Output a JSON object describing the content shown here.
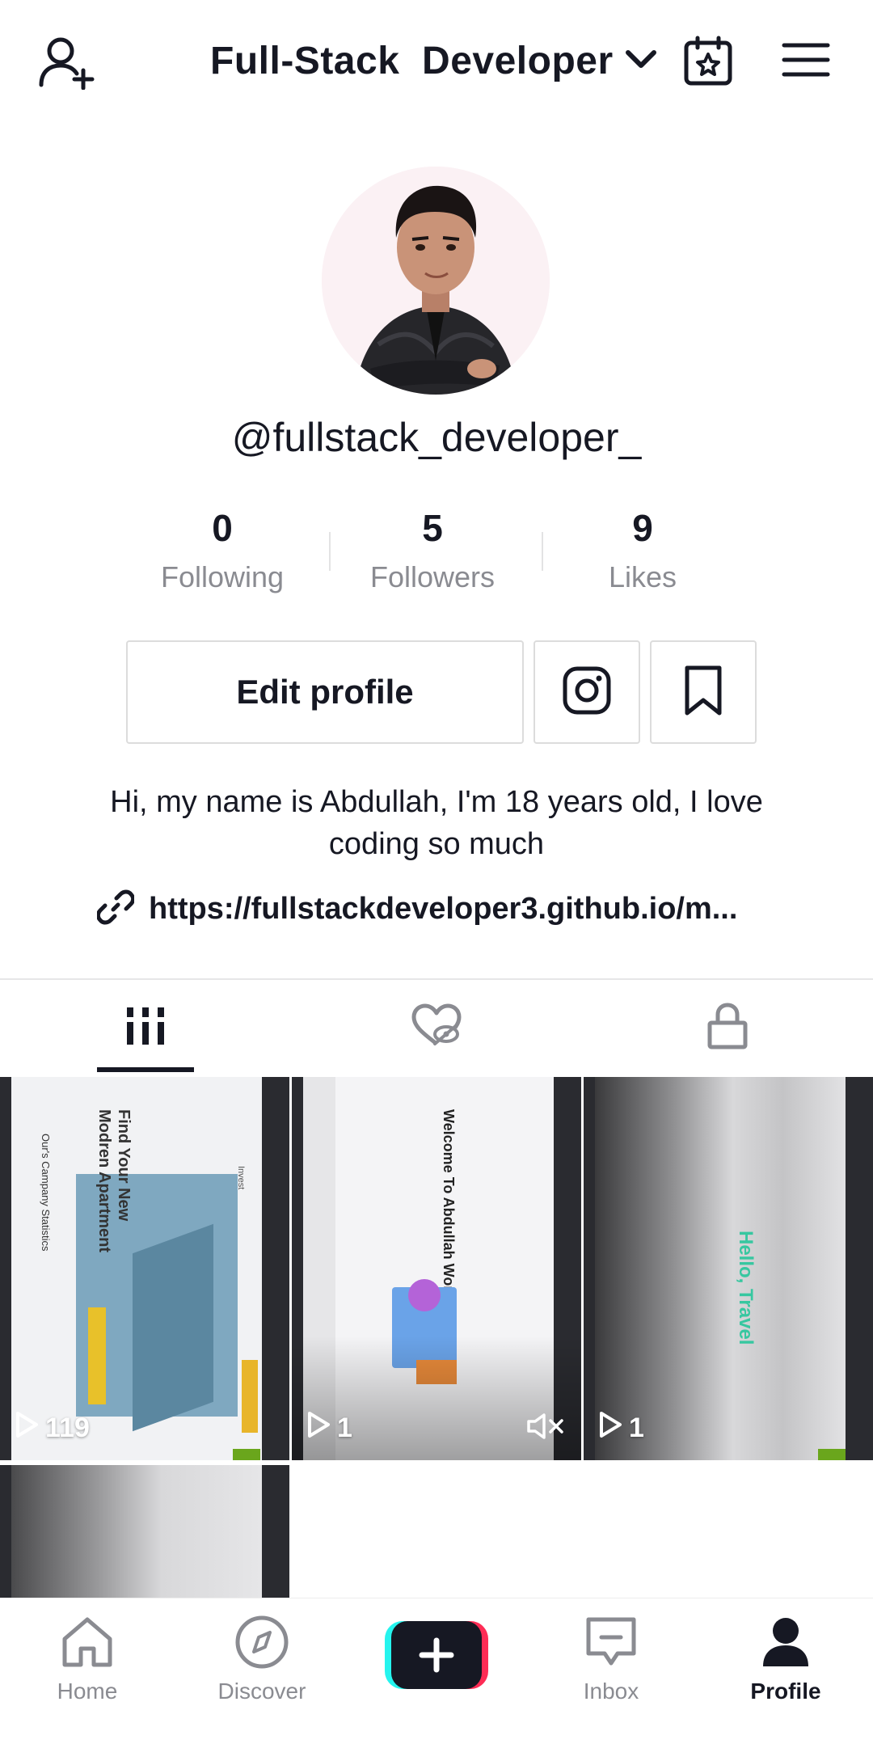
{
  "header": {
    "title": "Full-Stack  Developer",
    "add_user_icon": "person-add-icon",
    "dropdown_icon": "chevron-down-icon",
    "calendar_icon": "calendar-star-icon",
    "menu_icon": "hamburger-menu-icon"
  },
  "profile": {
    "username": "@fullstack_developer_",
    "bio": "Hi, my name is Abdullah, I'm 18 years old, I love coding so much",
    "link": "https://fullstackdeveloper3.github.io/m..."
  },
  "stats": [
    {
      "value": "0",
      "label": "Following"
    },
    {
      "value": "5",
      "label": "Followers"
    },
    {
      "value": "9",
      "label": "Likes"
    }
  ],
  "actions": {
    "edit_profile": "Edit profile",
    "instagram_icon": "instagram-icon",
    "bookmark_icon": "bookmark-icon"
  },
  "tabs": [
    {
      "icon": "grid-icon",
      "active": true
    },
    {
      "icon": "liked-hidden-icon",
      "active": false
    },
    {
      "icon": "lock-icon",
      "active": false
    }
  ],
  "videos": [
    {
      "views": "119",
      "muted": false,
      "theme": "real-estate",
      "texts": [
        "Find Your New",
        "Modren Apartment",
        "Our's Campany Statistics",
        "Invest"
      ]
    },
    {
      "views": "1",
      "muted": true,
      "theme": "welcome",
      "texts": [
        "Welcome To Abdullah World"
      ]
    },
    {
      "views": "1",
      "muted": false,
      "theme": "mountain",
      "texts": [
        "Hello, Travel"
      ]
    },
    {
      "views": "",
      "muted": false,
      "theme": "mountain2",
      "texts": []
    }
  ],
  "nav": [
    {
      "label": "Home",
      "icon": "home-icon",
      "active": false
    },
    {
      "label": "Discover",
      "icon": "compass-icon",
      "active": false
    },
    {
      "label": "",
      "icon": "plus-icon",
      "active": false
    },
    {
      "label": "Inbox",
      "icon": "inbox-icon",
      "active": false
    },
    {
      "label": "Profile",
      "icon": "person-icon",
      "active": true
    }
  ],
  "colors": {
    "text": "#161823",
    "muted": "#8a8b91",
    "create_cyan": "#25f4ee",
    "create_red": "#fe2c55"
  }
}
